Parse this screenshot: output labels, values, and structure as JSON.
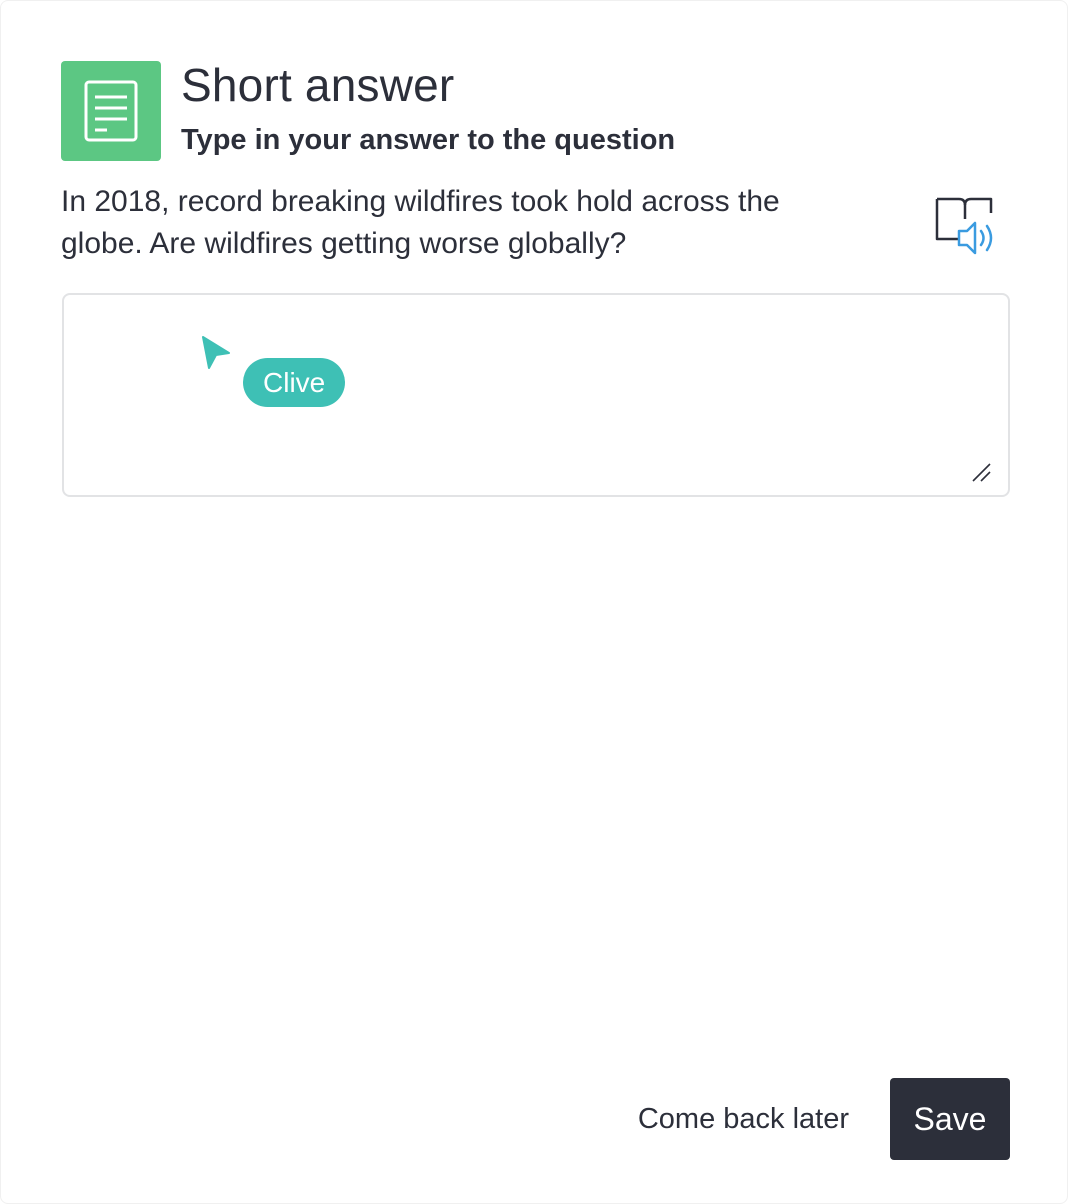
{
  "header": {
    "title": "Short answer",
    "subtitle": "Type in your answer to the question",
    "icon": "document-icon"
  },
  "question": {
    "text": "In 2018, record breaking wildfires took hold across the globe. Are wildfires getting worse globally?",
    "audio_icon": "read-aloud-icon"
  },
  "answer": {
    "value": "",
    "placeholder": ""
  },
  "collaborator": {
    "name": "Clive",
    "color": "#3ec0b5"
  },
  "footer": {
    "later_label": "Come back later",
    "save_label": "Save"
  },
  "colors": {
    "accent_green": "#5cc783",
    "dark": "#2c2f3a",
    "audio_blue": "#3a9be0"
  }
}
